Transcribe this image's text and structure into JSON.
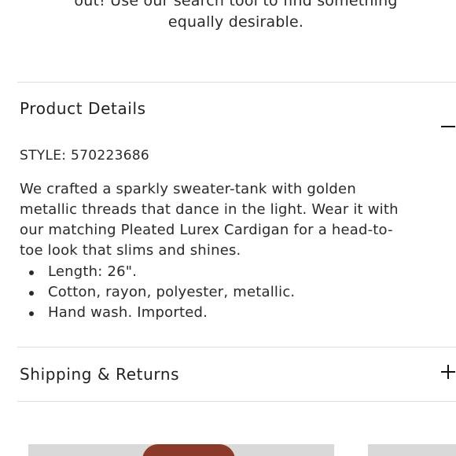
{
  "intro": {
    "lines": [
      "out! Use our search tool to find something",
      "equally desirable."
    ]
  },
  "product_details": {
    "title": "Product Details",
    "toggle_icon": "minus-icon",
    "style_line": "STYLE: 570223686",
    "description_lines": [
      "We crafted a sparkly sweater-tank with golden",
      "metallic threads that dance in the light. Wear it with",
      "our matching Pleated Lurex Cardigan for a head-to-",
      "toe look that slims and shines."
    ],
    "bullets": [
      "Length: 26\".",
      "Cotton, rayon, polyester, metallic.",
      "Hand wash. Imported."
    ]
  },
  "shipping_returns": {
    "title": "Shipping & Returns",
    "toggle_icon": "plus-icon"
  },
  "colors": {
    "divider": "#dcdcdc",
    "text": "#2a2a2a",
    "hair": "#8b3a2a",
    "thumbnail_bg": "#d9d9d9"
  }
}
